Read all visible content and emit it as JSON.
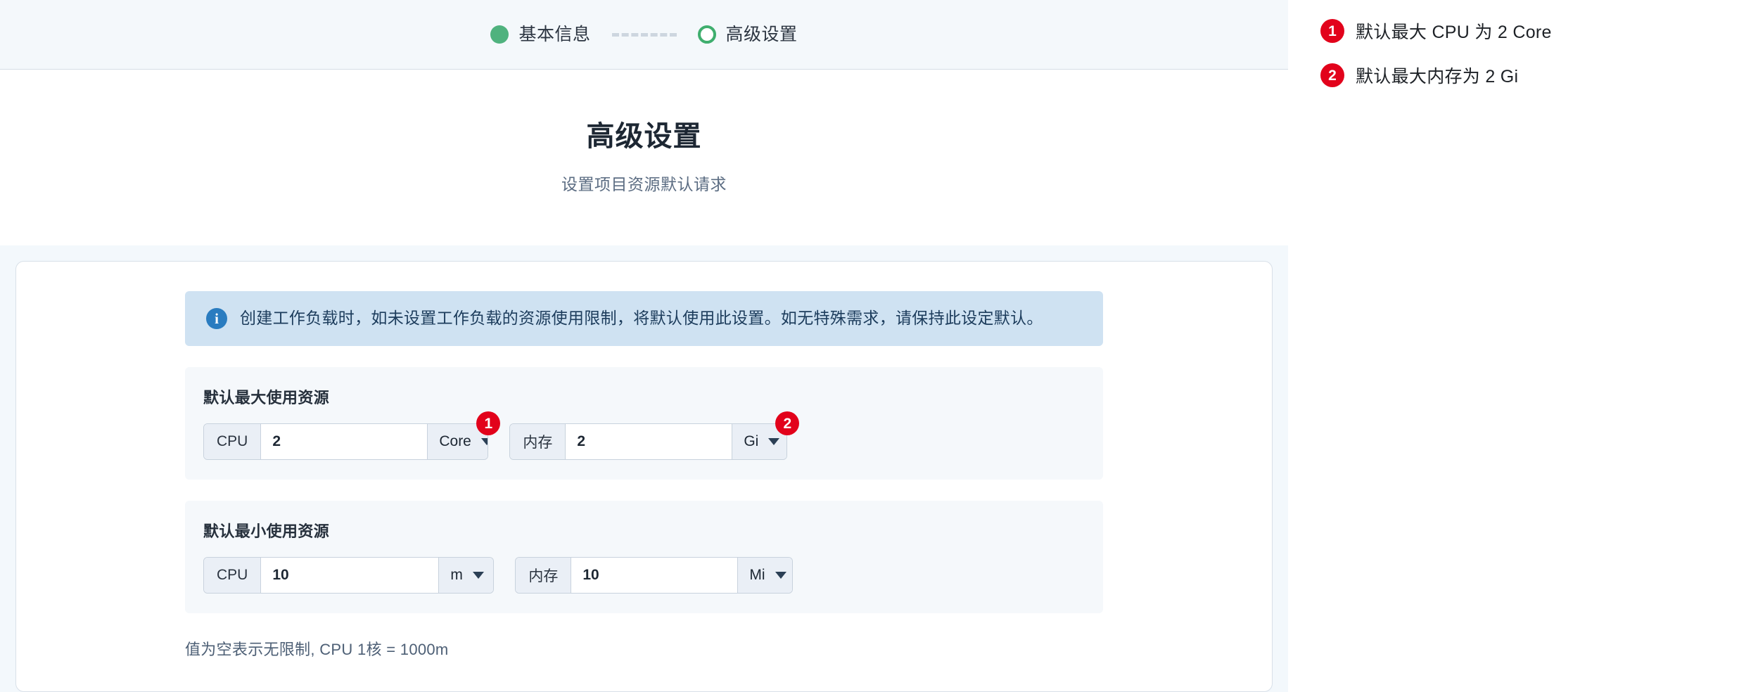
{
  "stepper": {
    "steps": [
      {
        "label": "基本信息",
        "state": "done",
        "icon": "filled-circle-icon"
      },
      {
        "label": "高级设置",
        "state": "current",
        "icon": "ring-circle-icon"
      }
    ],
    "connector_style": "dashed",
    "colors": {
      "done": "#4fb27e",
      "current_ring": "#3fae6e",
      "connector": "#cdd6df"
    }
  },
  "header": {
    "title": "高级设置",
    "subtitle": "设置项目资源默认请求"
  },
  "banner": {
    "icon": "info-circle-icon",
    "text": "创建工作负载时，如未设置工作负载的资源使用限制，将默认使用此设置。如无特殊需求，请保持此设定默认。",
    "background": "#cfe2f2",
    "icon_color": "#2a7cc0"
  },
  "sections": [
    {
      "title": "默认最大使用资源",
      "fields": [
        {
          "prefix": "CPU",
          "value": "2",
          "placeholder": "",
          "unit": "Core",
          "marker": "1"
        },
        {
          "prefix": "内存",
          "value": "2",
          "placeholder": "",
          "unit": "Gi",
          "marker": "2"
        }
      ]
    },
    {
      "title": "默认最小使用资源",
      "fields": [
        {
          "prefix": "CPU",
          "value": "10",
          "placeholder": "",
          "unit": "m",
          "marker": ""
        },
        {
          "prefix": "内存",
          "value": "10",
          "placeholder": "",
          "unit": "Mi",
          "marker": ""
        }
      ]
    }
  ],
  "footer": {
    "hint": "值为空表示无限制, CPU 1核 = 1000m"
  },
  "annotations": {
    "marker_color": "#e2021b",
    "items": [
      {
        "number": "1",
        "text": "默认最大 CPU 为 2 Core"
      },
      {
        "number": "2",
        "text": "默认最大内存为 2 Gi"
      }
    ]
  }
}
